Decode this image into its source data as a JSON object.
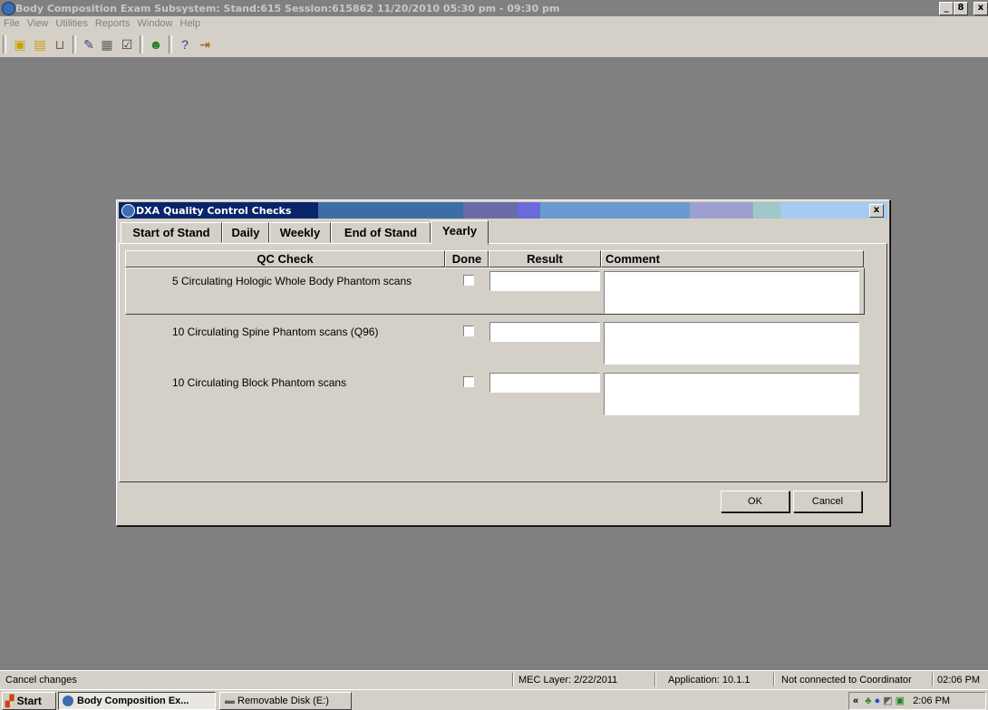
{
  "window": {
    "title": "Body Composition Exam Subsystem: Stand:615 Session:615862 11/20/2010 05:30 pm - 09:30 pm",
    "controls": [
      "_",
      "8",
      "x"
    ]
  },
  "menu": [
    "File",
    "View",
    "Utilities",
    "Reports",
    "Window",
    "Help"
  ],
  "toolbar_icons": [
    "new-icon",
    "clipboard-icon",
    "tray-icon",
    "wand-icon",
    "list-icon",
    "check-icon",
    "people-icon",
    "help-icon",
    "exit-icon"
  ],
  "dialog": {
    "title": "DXA Quality Control Checks",
    "close": "x",
    "tabs": [
      "Start of Stand",
      "Daily",
      "Weekly",
      "End of Stand",
      "Yearly"
    ],
    "active_tab": "Yearly",
    "columns": [
      "QC Check",
      "Done",
      "Result",
      "Comment"
    ],
    "rows": [
      {
        "check": "5 Circulating Hologic Whole Body Phantom scans",
        "done": false,
        "result": "",
        "comment": ""
      },
      {
        "check": "10 Circulating Spine Phantom scans (Q96)",
        "done": false,
        "result": "",
        "comment": ""
      },
      {
        "check": "10 Circulating Block Phantom scans",
        "done": false,
        "result": "",
        "comment": ""
      }
    ],
    "ok_label": "OK",
    "cancel_label": "Cancel"
  },
  "status": {
    "message": "Cancel changes",
    "mec_layer": "MEC Layer: 2/22/2011",
    "application": "Application: 10.1.1",
    "coordinator": "Not connected to Coordinator",
    "time": "02:06 PM"
  },
  "taskbar": {
    "start": "Start",
    "tasks": [
      "Body Composition Ex...",
      "Removable Disk (E:)"
    ],
    "tray_chevron": "«",
    "clock": "2:06 PM"
  }
}
